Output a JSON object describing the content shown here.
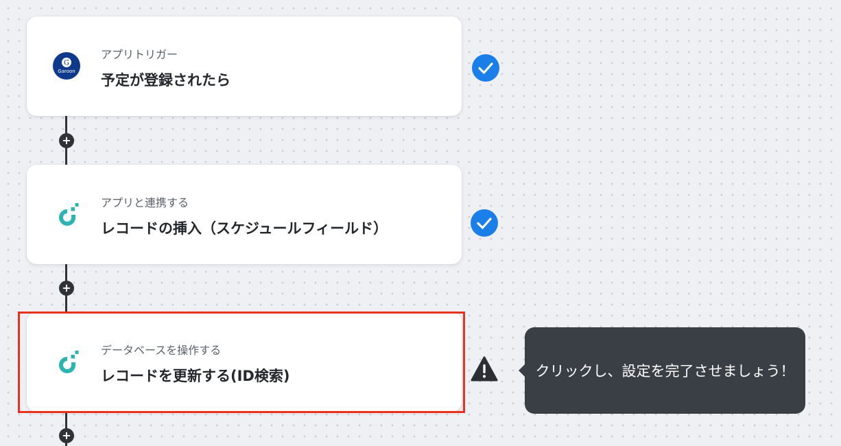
{
  "colors": {
    "accent_blue": "#1a7fe8",
    "highlight_red": "#e8321e",
    "tooltip_bg": "#3a3e45",
    "connector": "#2f3237",
    "garoon_navy": "#0f3a8c",
    "app_teal": "#2bb5b0"
  },
  "flow": {
    "steps": [
      {
        "kind": "アプリトリガー",
        "title": "予定が登録されたら",
        "app_icon": "garoon-logo-icon",
        "status": "completed"
      },
      {
        "kind": "アプリと連携する",
        "title": "レコードの挿入（スケジュールフィールド）",
        "app_icon": "teal-app-logo-icon",
        "status": "completed"
      },
      {
        "kind": "データベースを操作する",
        "title": "レコードを更新する(ID検索)",
        "app_icon": "teal-app-logo-icon",
        "status": "warning"
      }
    ],
    "add_button_symbol": "+"
  },
  "garoon_logo": {
    "letter": "G",
    "wordmark": "Garoon"
  },
  "tooltip": {
    "text": "クリックし、設定を完了させましょう！"
  }
}
